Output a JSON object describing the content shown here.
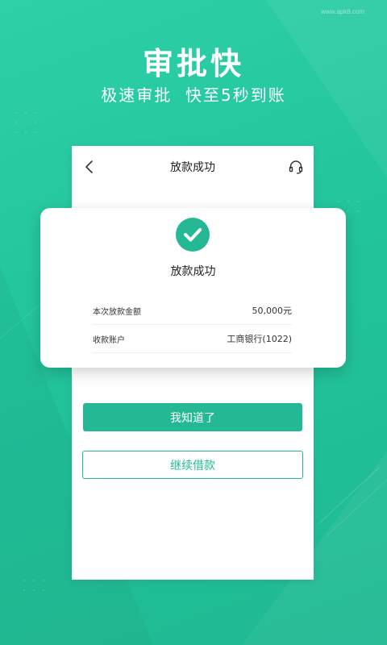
{
  "watermark": "www.apk8.com",
  "promo": {
    "headline": "审批快",
    "subline": "极速审批  快至5秒到账"
  },
  "screen": {
    "header_title": "放款成功",
    "back_icon": "chevron-left-icon",
    "support_icon": "headset-icon"
  },
  "result_card": {
    "status_icon": "check-circle-icon",
    "title": "放款成功",
    "rows": [
      {
        "label": "本次放款金额",
        "value": "50,000元"
      },
      {
        "label": "收款账户",
        "value": "工商银行(1022)"
      }
    ]
  },
  "actions": {
    "confirm_label": "我知道了",
    "continue_label": "继续借款"
  },
  "colors": {
    "brand": "#24b994",
    "background": "#22c49c"
  }
}
